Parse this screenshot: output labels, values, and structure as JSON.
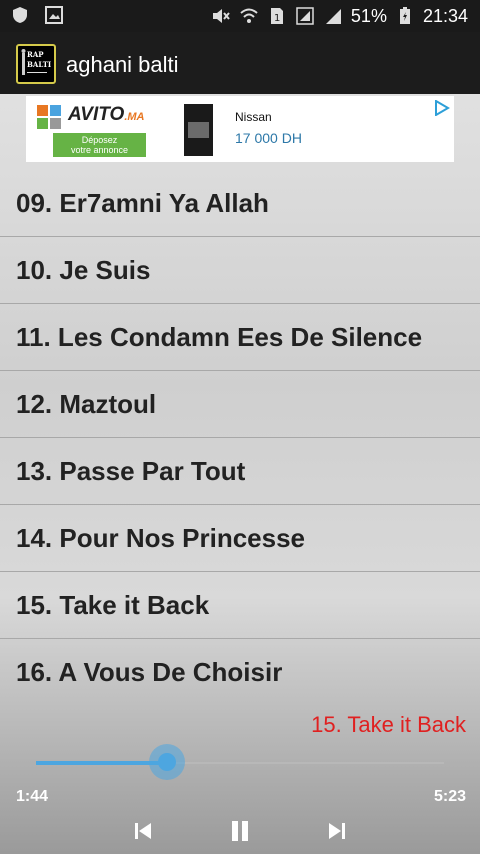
{
  "status_bar": {
    "battery_percent": "51%",
    "time": "21:34",
    "icons": [
      "shield-icon",
      "image-icon",
      "mute-icon",
      "wifi-icon",
      "sim-icon",
      "signal-icon",
      "signal-icon",
      "battery-icon"
    ]
  },
  "action_bar": {
    "title": "aghani balti",
    "app_icon_text": [
      "RAP",
      "BALTI"
    ]
  },
  "ad": {
    "brand": "AVITO",
    "brand_suffix": ".MA",
    "cta_line1": "Déposez",
    "cta_line2": "votre annonce",
    "item": "Nissan",
    "price": "17 000 DH"
  },
  "songs": [
    "09. Er7amni Ya Allah",
    "10. Je Suis",
    "11. Les Condamn Ees De Silence",
    "12. Maztoul",
    "13. Passe Par Tout",
    "14. Pour Nos Princesse",
    "15. Take it Back",
    "16. A Vous De Choisir"
  ],
  "player": {
    "now_playing": "15. Take it Back",
    "elapsed": "1:44",
    "total": "5:23",
    "progress_fraction": 0.32
  },
  "colors": {
    "accent": "#4da6e0",
    "now_playing": "#e02020",
    "background": "#d8d8d8"
  }
}
